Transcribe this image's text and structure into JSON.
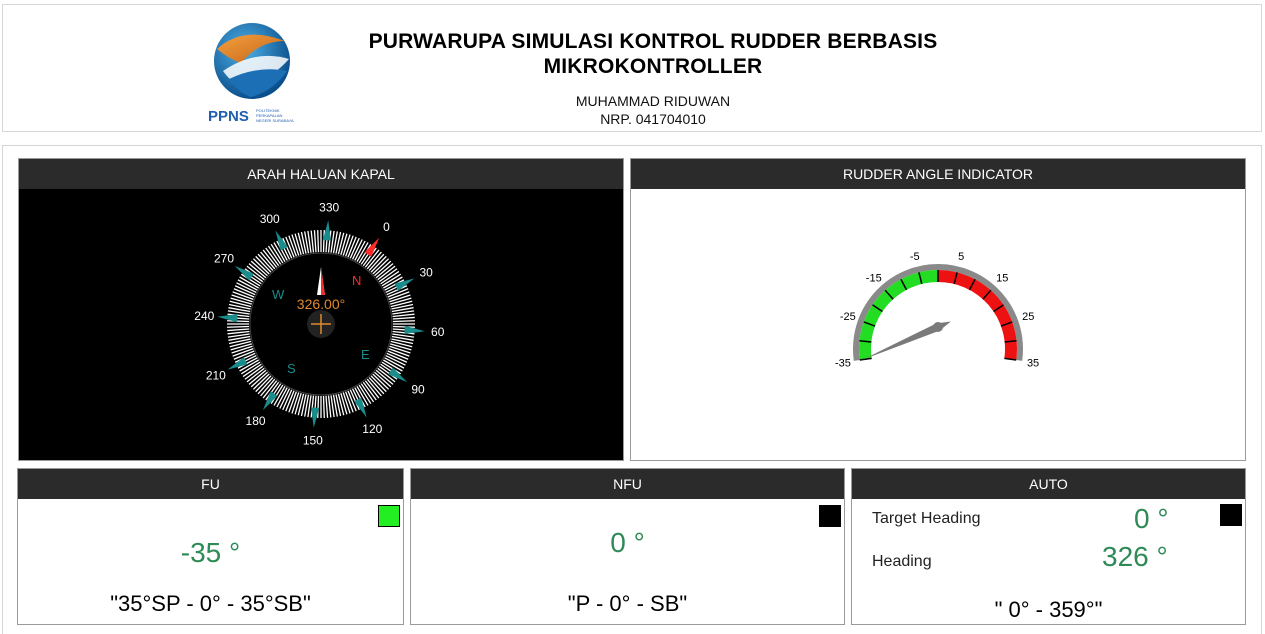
{
  "header": {
    "logo_text": "PPNS",
    "logo_subtext": [
      "POLITEKNIK",
      "PERKAPALAN",
      "NEGERI SURABAYA"
    ],
    "title_line1": "PURWARUPA SIMULASI KONTROL RUDDER BERBASIS",
    "title_line2": "MIKROKONTROLLER",
    "author": "MUHAMMAD RIDUWAN",
    "nrp": "NRP. 041704010"
  },
  "compass": {
    "title": "ARAH HALUAN KAPAL",
    "heading_value": 326,
    "heading_text": "326.00°",
    "cardinal": {
      "north": "N",
      "east": "E",
      "south": "S",
      "west": "W"
    },
    "tick_labels": [
      "0",
      "30",
      "60",
      "90",
      "120",
      "150",
      "180",
      "210",
      "240",
      "270",
      "300",
      "330"
    ],
    "colors": {
      "marker": "#ff2a2a",
      "triangles": "#1a8c8c",
      "heading_text": "#e08a2c"
    }
  },
  "rudder": {
    "title": "RUDDER ANGLE INDICATOR",
    "value": -35,
    "min": -35,
    "max": 35,
    "scale_labels": [
      "-35",
      "-25",
      "-15",
      "-5",
      "5",
      "15",
      "25",
      "35"
    ],
    "colors": {
      "port": "#22dd22",
      "starboard": "#ee1111",
      "bezel": "#8a8a8a"
    }
  },
  "fu": {
    "title": "FU",
    "value_text": "-35 °",
    "range_text": "\"35°SP - 0° - 35°SB\"",
    "indicator_color": "#22ee22"
  },
  "nfu": {
    "title": "NFU",
    "value_text": "0 °",
    "range_text": "\"P - 0° - SB\"",
    "indicator_color": "#000000"
  },
  "auto": {
    "title": "AUTO",
    "target_label": "Target Heading",
    "target_value": "0 °",
    "heading_label": "Heading",
    "heading_value": "326 °",
    "range_text": "\" 0° - 359°\"",
    "indicator_color": "#000000"
  }
}
